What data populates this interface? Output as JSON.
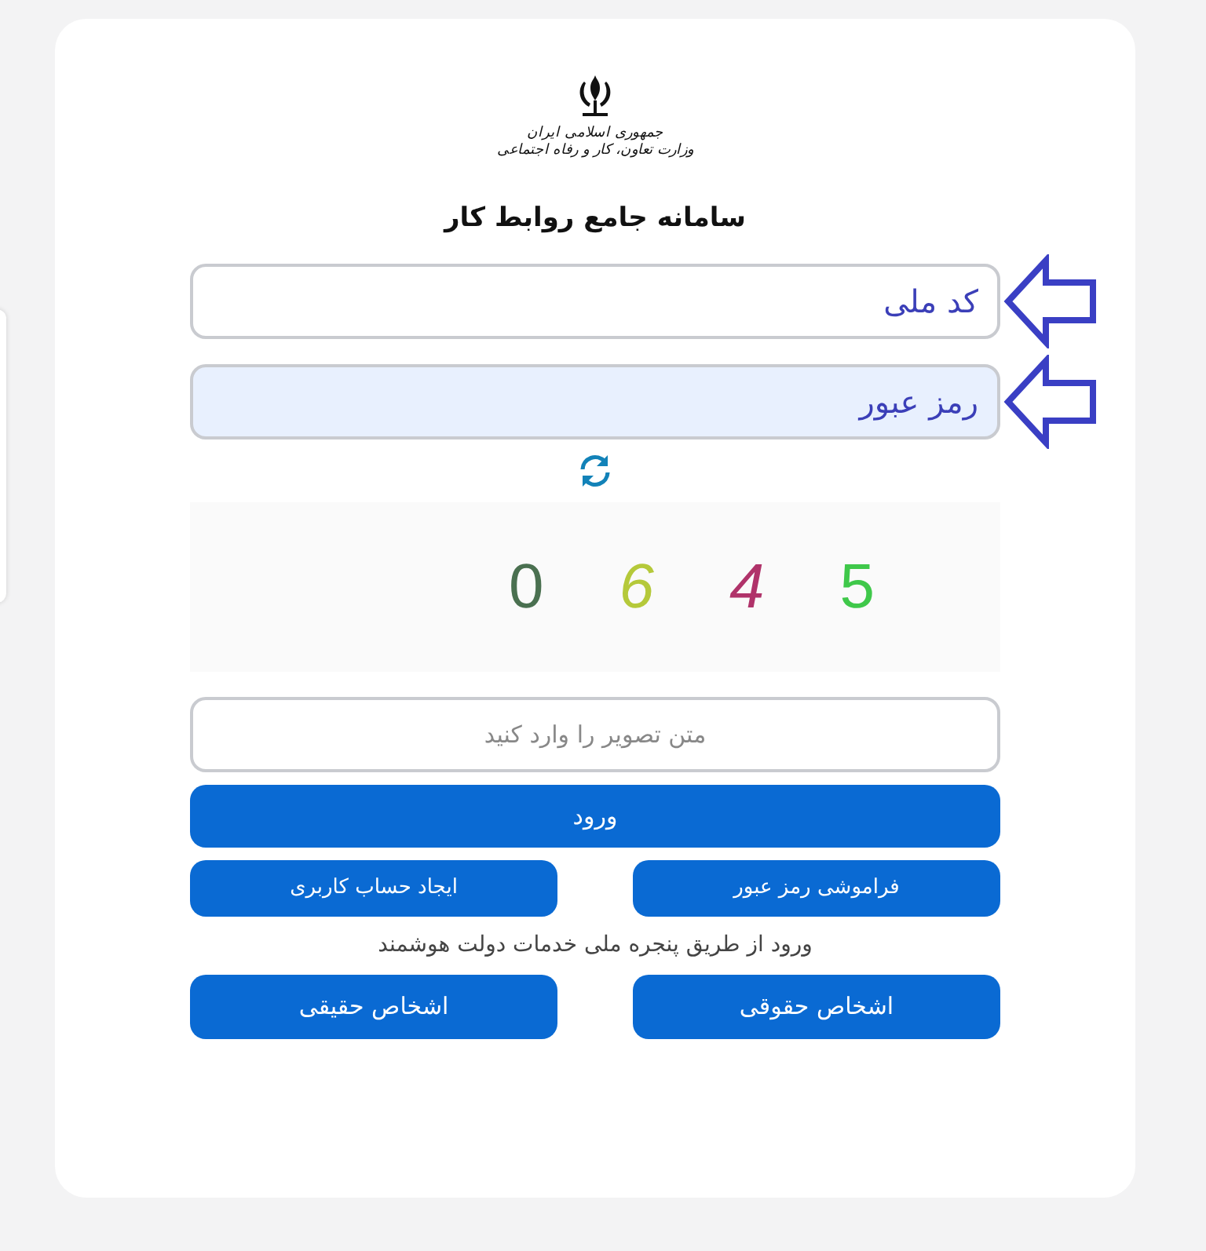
{
  "logo": {
    "lines": [
      "جمهوری اسلامی ایران",
      "وزارت تعاون، کار و رفاه اجتماعی"
    ]
  },
  "title": "سامانه جامع روابط کار",
  "fields": [
    {
      "value": "کد ملی",
      "autofilled": false,
      "pointer_arrow": true
    },
    {
      "value": "رمز عبور",
      "autofilled": true,
      "pointer_arrow": true
    }
  ],
  "captcha": {
    "digits": [
      {
        "text": "5",
        "color": "#3fc84a"
      },
      {
        "text": "4",
        "color": "#b0336a"
      },
      {
        "text": "6",
        "color": "#b5c93a"
      },
      {
        "text": "0",
        "color": "#4a7050"
      }
    ],
    "input": {
      "placeholder": "متن تصویر را وارد کنید"
    }
  },
  "login_button": "ورود",
  "account_buttons": [
    "فراموشی رمز عبور",
    "ایجاد حساب کاربری"
  ],
  "gov_login_text": "ورود از طریق پنجره ملی خدمات دولت هوشمند",
  "gov_buttons": [
    "اشخاص حقوقی",
    "اشخاص حقیقی"
  ]
}
